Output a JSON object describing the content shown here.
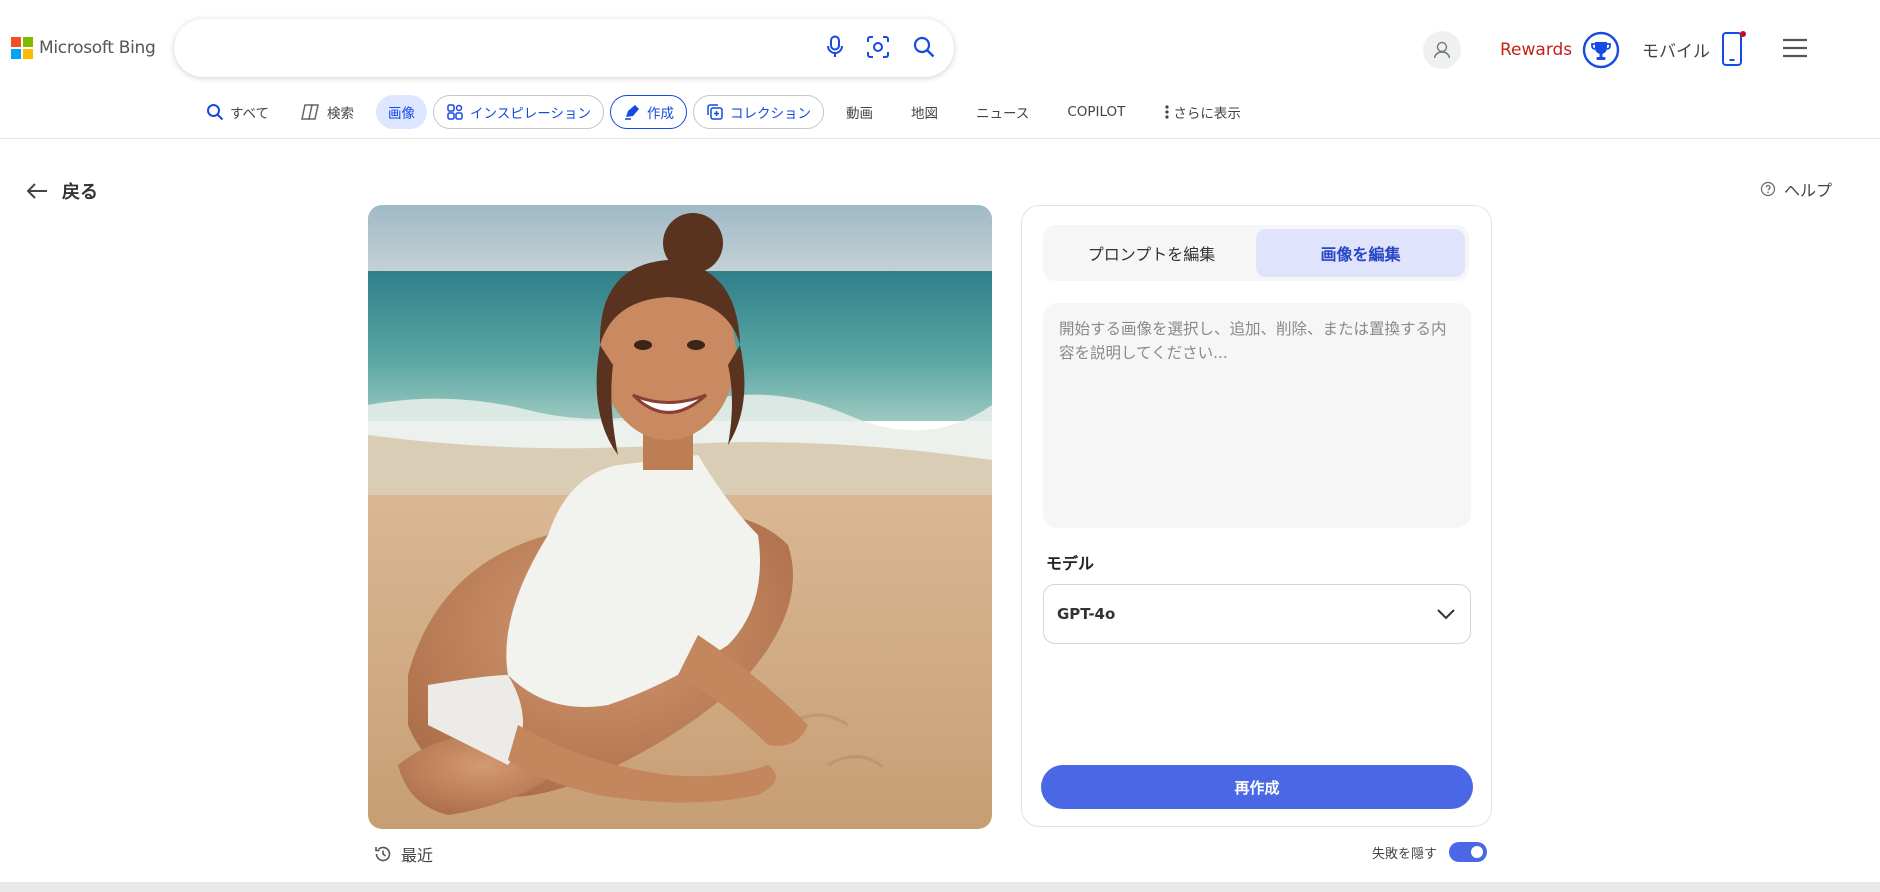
{
  "header": {
    "brand": "Microsoft Bing",
    "search": {
      "value": ""
    },
    "rewards_label": "Rewards",
    "mobile_label": "モバイル"
  },
  "nav": {
    "items": [
      {
        "label": "すべて",
        "icon": "search-icon"
      },
      {
        "label": "検索",
        "icon": "copilot-icon"
      },
      {
        "label": "画像",
        "state": "active"
      },
      {
        "label": "インスピレーション",
        "icon": "inspiration-icon"
      },
      {
        "label": "作成",
        "icon": "create-icon",
        "state": "selected"
      },
      {
        "label": "コレクション",
        "icon": "collection-icon"
      },
      {
        "label": "動画"
      },
      {
        "label": "地図"
      },
      {
        "label": "ニュース"
      },
      {
        "label": "COPILOT"
      },
      {
        "label": "さらに表示",
        "icon": "more-vertical-icon"
      }
    ]
  },
  "page": {
    "back_label": "戻る",
    "help_label": "ヘルプ"
  },
  "editor": {
    "tabs": [
      {
        "label": "プロンプトを編集",
        "selected": false
      },
      {
        "label": "画像を編集",
        "selected": true
      }
    ],
    "prompt_placeholder": "開始する画像を選択し、追加、削除、または置換する内容を説明してください...",
    "model_label": "モデル",
    "model_value": "GPT-4o",
    "create_button": "再作成"
  },
  "footer": {
    "recent_label": "最近",
    "hide_failures_label": "失敗を隠す",
    "hide_failures_on": true
  },
  "colors": {
    "accent": "#4a68e6",
    "nav_active_bg": "#dfe6ff",
    "rewards_red": "#c5211a",
    "link_blue": "#174ae4"
  }
}
